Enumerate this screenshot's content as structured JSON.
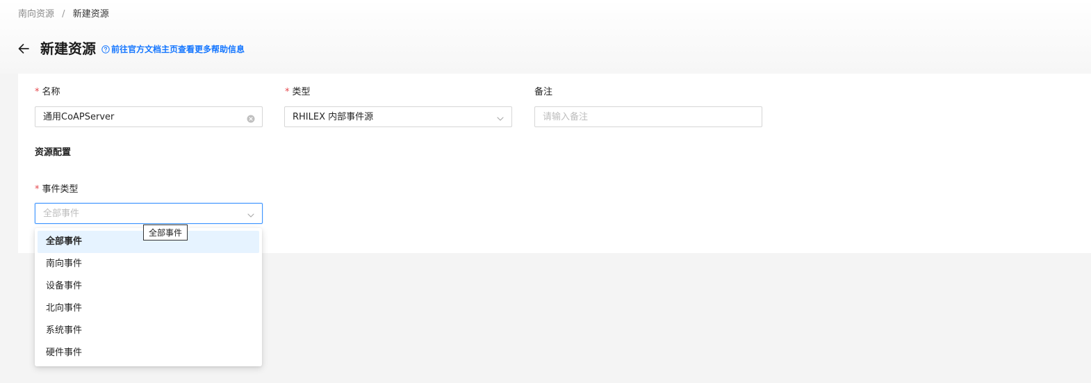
{
  "breadcrumb": {
    "parent": "南向资源",
    "separator": "/",
    "current": "新建资源"
  },
  "header": {
    "back_icon": "arrow-left-icon",
    "title": "新建资源",
    "help_icon": "question-circle-icon",
    "help_link": "前往官方文档主页查看更多帮助信息"
  },
  "form": {
    "name": {
      "label": "名称",
      "required_mark": "*",
      "value": "通用CoAPServer",
      "clear_icon": "clear-icon"
    },
    "type": {
      "label": "类型",
      "required_mark": "*",
      "value": "RHILEX 内部事件源",
      "arrow_icon": "chevron-down-icon"
    },
    "remark": {
      "label": "备注",
      "placeholder": "请输入备注"
    },
    "section_title": "资源配置",
    "event_type": {
      "label": "事件类型",
      "required_mark": "*",
      "placeholder": "全部事件",
      "arrow_icon": "chevron-down-icon",
      "tooltip": "全部事件",
      "options": [
        "全部事件",
        "南向事件",
        "设备事件",
        "北向事件",
        "系统事件",
        "硬件事件"
      ],
      "selected": "全部事件"
    }
  },
  "colors": {
    "accent": "#1677ff",
    "required": "#e5484d",
    "option_selected_bg": "#e6f3ff",
    "focus_border": "#4096ff"
  }
}
